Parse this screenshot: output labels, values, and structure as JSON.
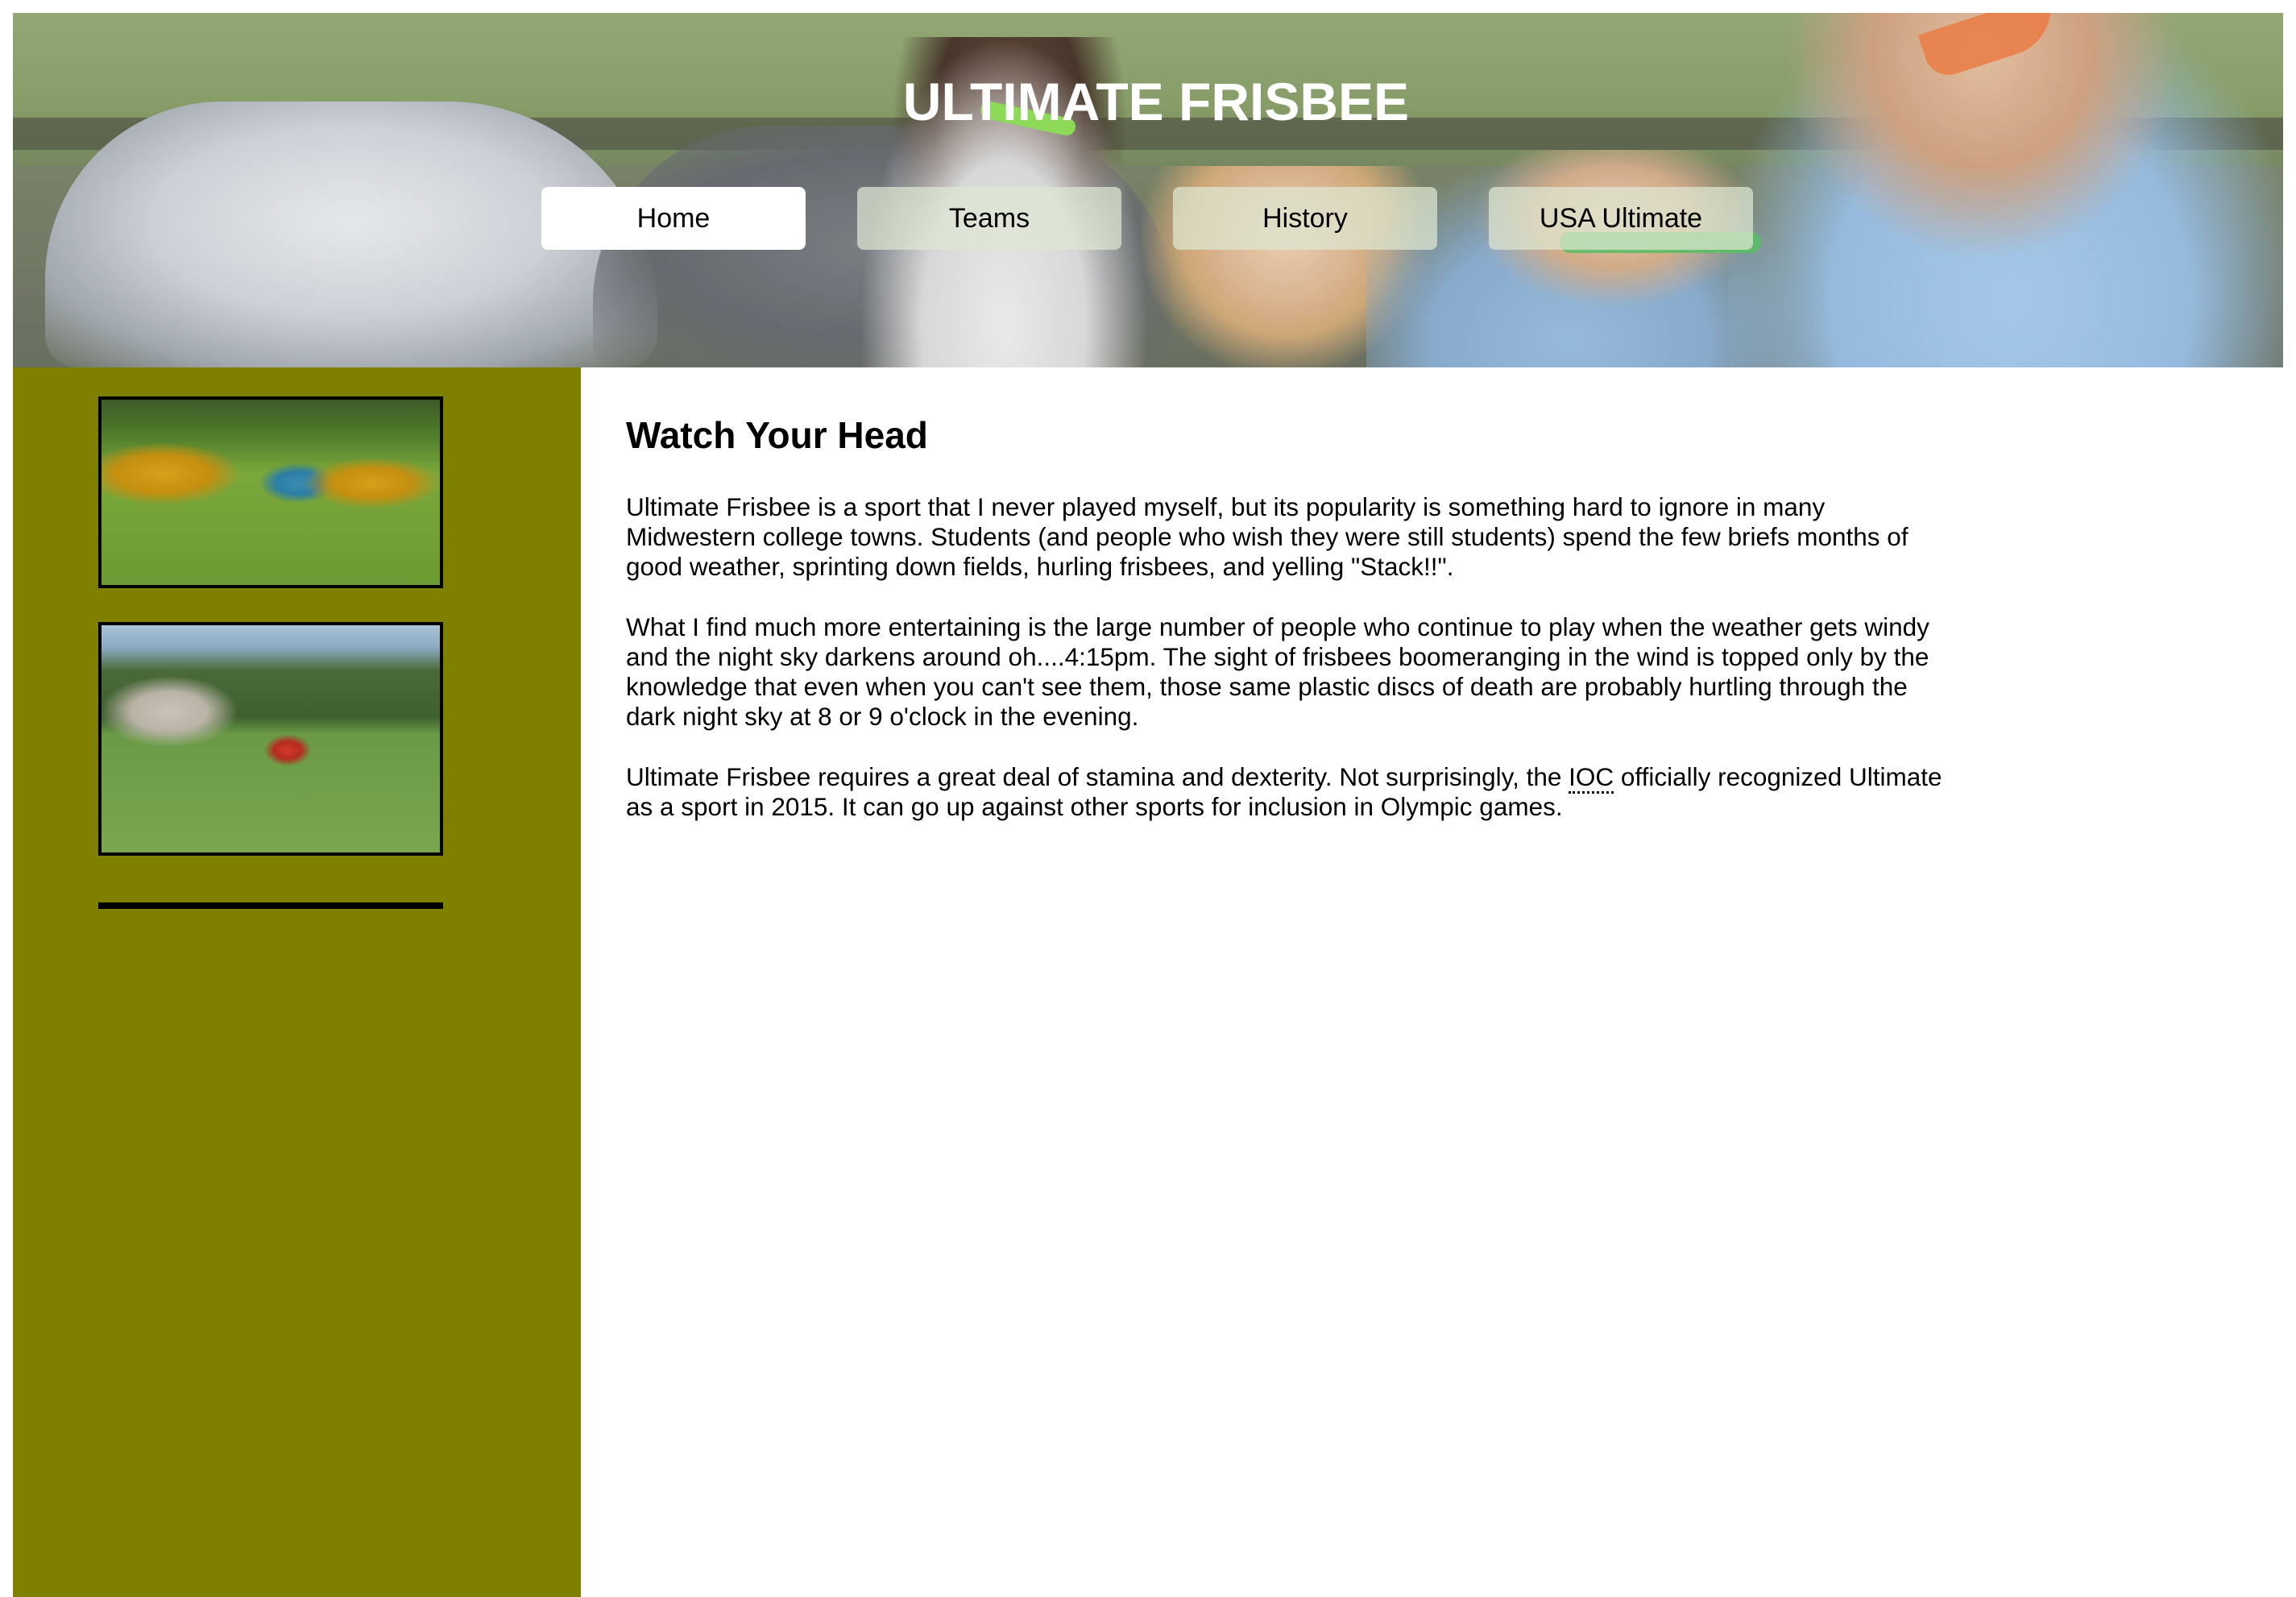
{
  "header": {
    "title": "ULTIMATE FRISBEE",
    "nav": [
      {
        "label": "Home",
        "active": true
      },
      {
        "label": "Teams",
        "active": false
      },
      {
        "label": "History",
        "active": false
      },
      {
        "label": "USA Ultimate",
        "active": false
      }
    ]
  },
  "sidebar": {
    "background_color": "#7f7f00",
    "images": [
      {
        "name": "ultimate-frisbee-game-photo"
      },
      {
        "name": "frisbee-player-field-photo"
      }
    ]
  },
  "main": {
    "heading": "Watch Your Head",
    "paragraphs": [
      "Ultimate Frisbee is a sport that I never played myself, but its popularity is something hard to ignore in many Midwestern college towns. Students (and people who wish they were still students) spend the few briefs months of good weather, sprinting down fields, hurling frisbees, and yelling \"Stack!!\".",
      "What I find much more entertaining is the large number of people who continue to play when the weather gets windy and the night sky darkens around oh....4:15pm. The sight of frisbees boomeranging in the wind is topped only by the knowledge that even when you can't see them, those same plastic discs of death are probably hurtling through the dark night sky at 8 or 9 o'clock in the evening."
    ],
    "paragraph3": {
      "before": "Ultimate Frisbee requires a great deal of stamina and dexterity. Not surprisingly, the ",
      "abbr": "IOC",
      "after": " officially recognized Ultimate as a sport in 2015. It can go up against other sports for inclusion in Olympic games."
    }
  }
}
